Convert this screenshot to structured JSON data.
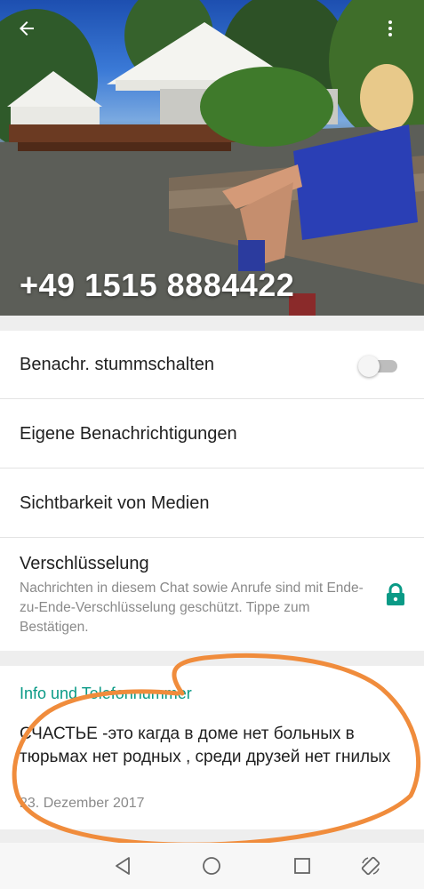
{
  "header": {
    "phone_number": "+49 1515 8884422",
    "back_icon": "arrow-left-icon",
    "more_icon": "more-vert-icon"
  },
  "settings": {
    "mute_label": "Benachr. stummschalten",
    "mute_enabled": false,
    "custom_notifications_label": "Eigene Benachrichtigungen",
    "media_visibility_label": "Sichtbarkeit von Medien",
    "encryption_label": "Verschlüsselung",
    "encryption_desc": "Nachrichten in diesem Chat sowie Anrufe sind mit Ende-zu-Ende-Verschlüsselung geschützt. Tippe zum Bestätigen.",
    "lock_icon": "lock-icon"
  },
  "about": {
    "heading": "Info und Telefonnummer",
    "text": "СЧАСТЬЕ -это кагда в доме нет больных в тюрьмах нет родных , среди друзей нет гнилых",
    "date": "23. Dezember 2017"
  },
  "colors": {
    "accent": "#0a9a86",
    "annotation": "#f08c3c"
  },
  "navbar": {
    "icons": [
      "back-triangle-icon",
      "home-circle-icon",
      "recents-square-icon",
      "rotate-icon"
    ]
  }
}
